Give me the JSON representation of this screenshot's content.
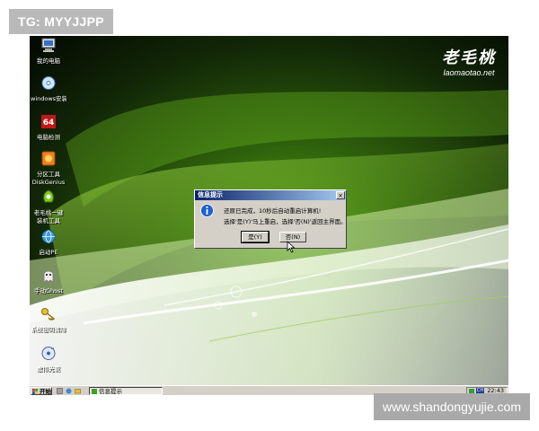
{
  "watermarks": {
    "top_left": "TG: MYYJJPP",
    "bottom_right": "www.shandongyujie.com"
  },
  "logo": {
    "mark": "老毛桃",
    "site": "laomaotao.net"
  },
  "desktop_icons": [
    {
      "label": "我的电脑",
      "icon": "computer-icon"
    },
    {
      "label": "windows安装",
      "icon": "install-disc-icon"
    },
    {
      "label": "电脑检测",
      "icon": "64-test-icon"
    },
    {
      "label": "分区工具",
      "label2": "DiskGenius",
      "icon": "disk-tool-icon"
    },
    {
      "label": "老毛桃一键",
      "label2": "装机工具",
      "icon": "one-key-install-icon"
    },
    {
      "label": "启动PE",
      "icon": "network-globe-icon"
    },
    {
      "label": "手动Ghost",
      "icon": "ghost-icon"
    },
    {
      "label": "系统密码清除",
      "icon": "key-icon"
    },
    {
      "label": "虚拟光驱",
      "icon": "virtual-drive-icon"
    }
  ],
  "dialog": {
    "title": "信息提示",
    "message1": "还原已完成，10秒后自动重启计算机!",
    "message2": "选择'是(Y)'马上重启，选择'否(N)'返回主界面。",
    "yes_label": "是(Y)",
    "no_label": "否(N)",
    "close_label": "×"
  },
  "taskbar": {
    "start_label": "开始",
    "task_label": "信息提示",
    "tray_lang": "CH",
    "clock": "22:43"
  }
}
